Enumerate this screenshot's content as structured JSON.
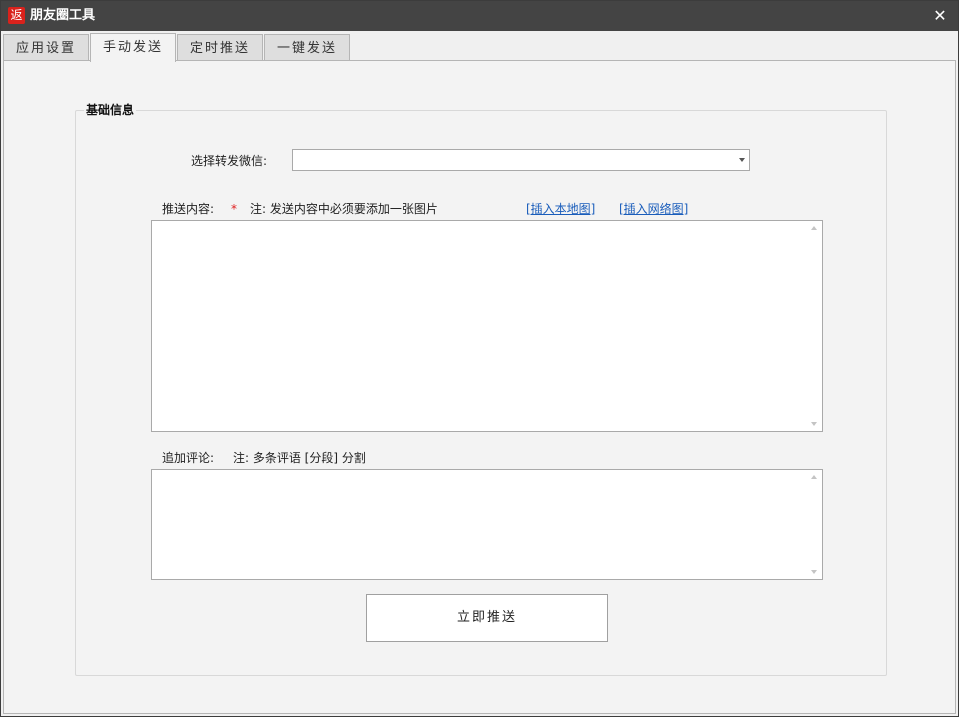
{
  "window": {
    "app_icon_glyph": "返",
    "title": "朋友圈工具",
    "close_glyph": "✕"
  },
  "tabs": [
    {
      "label": "应用设置",
      "active": false
    },
    {
      "label": "手动发送",
      "active": true
    },
    {
      "label": "定时推送",
      "active": false
    },
    {
      "label": "一键发送",
      "active": false
    }
  ],
  "group": {
    "legend": "基础信息",
    "wechat_select": {
      "label": "选择转发微信:",
      "value": ""
    },
    "push_content": {
      "label": "推送内容:",
      "required_mark": "*",
      "note": "注: 发送内容中必须要添加一张图片",
      "insert_local_image": "[插入本地图]",
      "insert_web_image": "[插入网络图]",
      "value": ""
    },
    "extra_comments": {
      "label": "追加评论:",
      "note": "注: 多条评语 [分段] 分割",
      "value": ""
    },
    "push_button": "立即推送"
  },
  "colors": {
    "titlebar": "#444444",
    "app_icon": "#d9221c",
    "required": "#e02020",
    "link": "#1a5dbb"
  }
}
